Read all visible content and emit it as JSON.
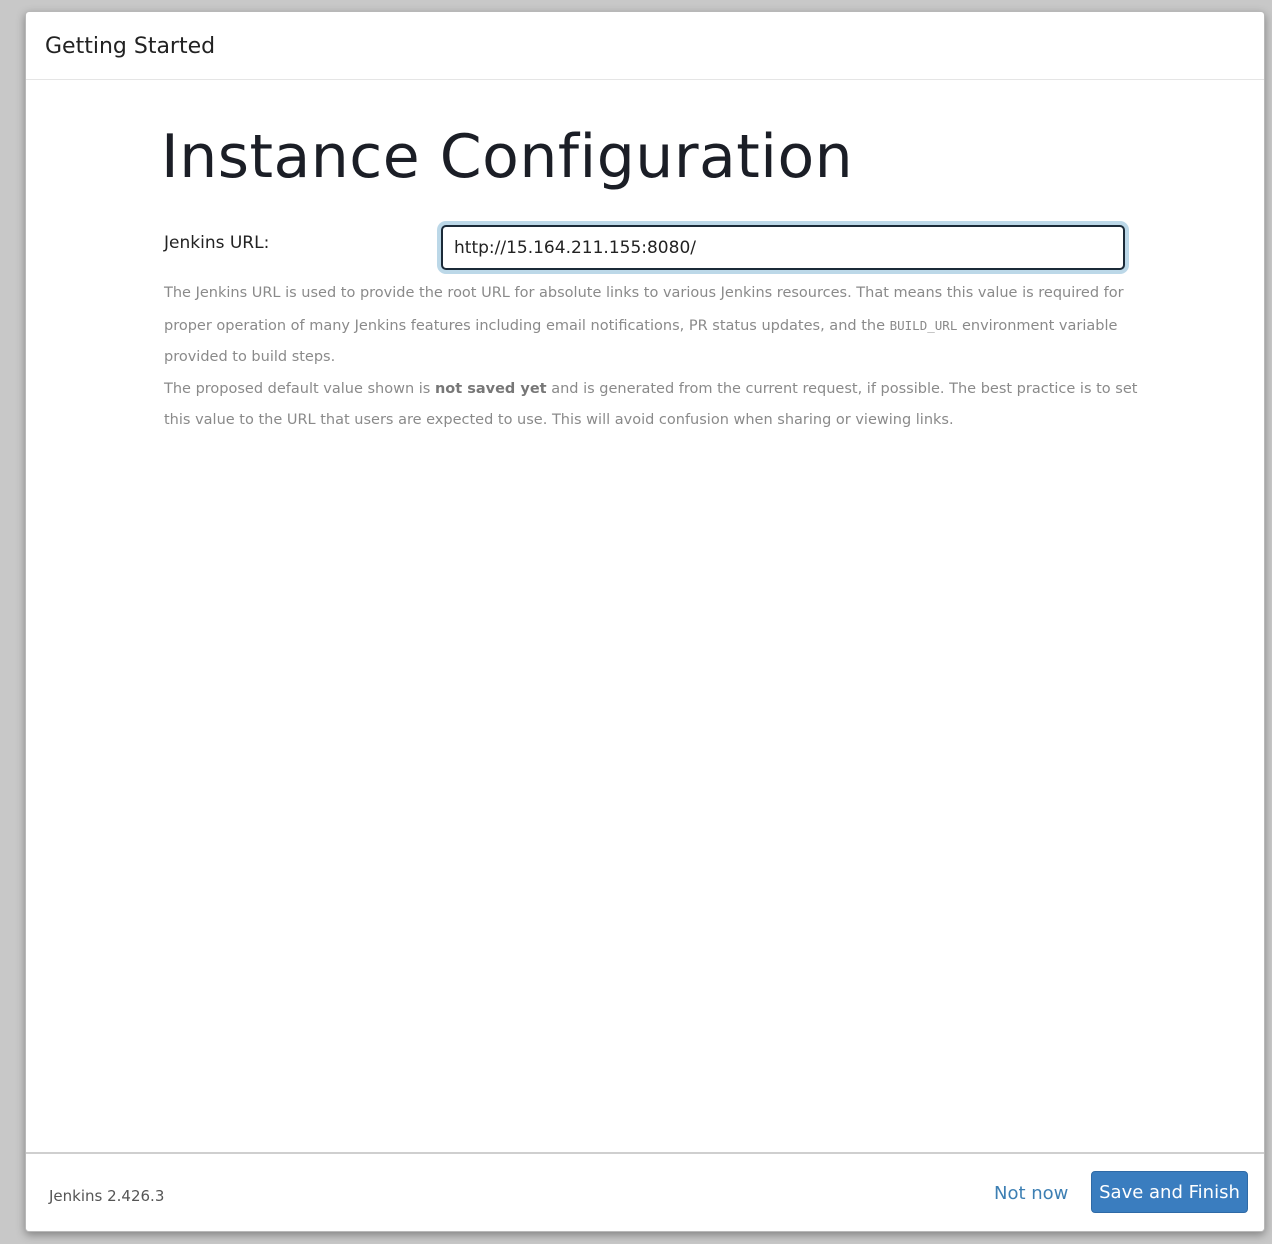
{
  "dialog": {
    "title": "Getting Started"
  },
  "main": {
    "heading": "Instance Configuration",
    "url_field": {
      "label": "Jenkins URL:",
      "value": "http://15.164.211.155:8080/"
    },
    "help": {
      "p1_text_a": "The Jenkins URL is used to provide the root URL for absolute links to various Jenkins resources. That means this value is required for proper operation of many Jenkins features including email notifications, PR status updates, and the ",
      "p1_code": "BUILD_URL",
      "p1_text_b": " environment variable provided to build steps.",
      "p2_text_a": "The proposed default value shown is ",
      "p2_strong": "not saved yet",
      "p2_text_b": " and is generated from the current request, if possible. The best practice is to set this value to the URL that users are expected to use. This will avoid confusion when sharing or viewing links."
    }
  },
  "footer": {
    "version": "Jenkins 2.426.3",
    "not_now_label": "Not now",
    "save_label": "Save and Finish"
  },
  "colors": {
    "primary_button": "#3a7dbf",
    "link": "#3d7fb3",
    "focus_ring": "#bcd8e8"
  }
}
